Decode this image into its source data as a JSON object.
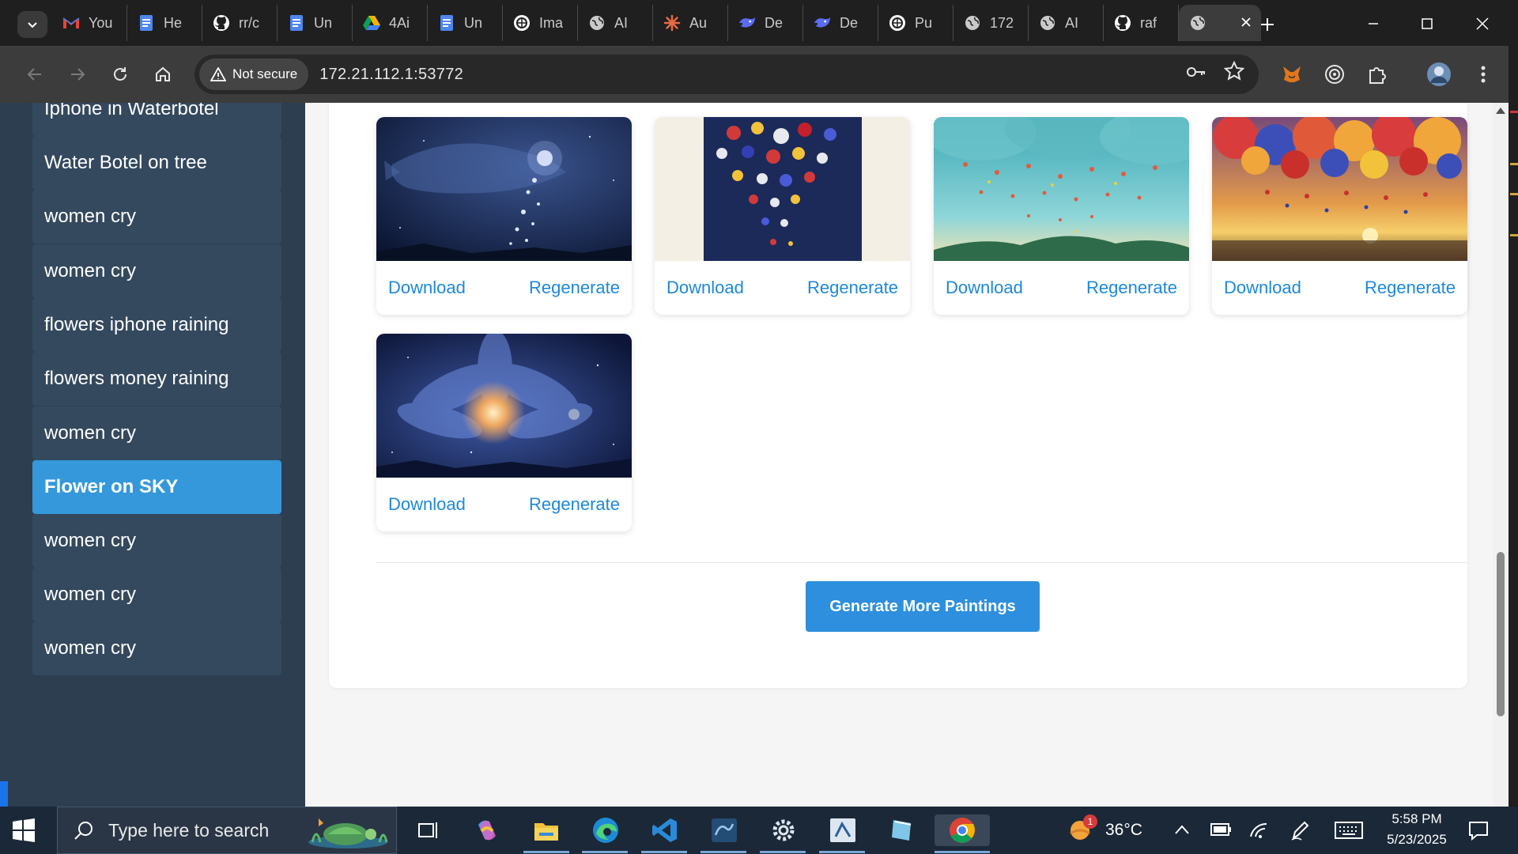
{
  "browser": {
    "tabs": [
      {
        "title": "You",
        "icon": "gmail-icon"
      },
      {
        "title": "He",
        "icon": "docs-icon"
      },
      {
        "title": "rr/c",
        "icon": "github-icon"
      },
      {
        "title": "Un",
        "icon": "docs-icon"
      },
      {
        "title": "4Ai",
        "icon": "drive-icon"
      },
      {
        "title": "Un",
        "icon": "docs-icon"
      },
      {
        "title": "Ima",
        "icon": "openai-icon"
      },
      {
        "title": "AI",
        "icon": "globe-icon"
      },
      {
        "title": "Au",
        "icon": "claude-icon"
      },
      {
        "title": "De",
        "icon": "deepseek-icon"
      },
      {
        "title": "De",
        "icon": "deepseek-icon"
      },
      {
        "title": "Pu",
        "icon": "openai-icon"
      },
      {
        "title": "172",
        "icon": "globe-icon"
      },
      {
        "title": "AI",
        "icon": "globe-icon"
      },
      {
        "title": "raf",
        "icon": "github-icon"
      }
    ],
    "active_tab_icon": "globe-icon",
    "security_label": "Not secure",
    "url": "172.21.112.1:53772"
  },
  "sidebar": {
    "items": [
      {
        "label": "Iphone in Waterbotel",
        "active": false
      },
      {
        "label": "Water Botel on tree",
        "active": false
      },
      {
        "label": "women cry",
        "active": false
      },
      {
        "label": "women cry",
        "active": false
      },
      {
        "label": "flowers iphone raining",
        "active": false
      },
      {
        "label": "flowers money raining",
        "active": false
      },
      {
        "label": "women cry",
        "active": false
      },
      {
        "label": "Flower on SKY",
        "active": true
      },
      {
        "label": "women cry",
        "active": false
      },
      {
        "label": "women cry",
        "active": false
      },
      {
        "label": "women cry",
        "active": false
      }
    ]
  },
  "gallery": {
    "cards": [
      {
        "image": "starry-whale-painting",
        "download_label": "Download",
        "regenerate_label": "Regenerate"
      },
      {
        "image": "falling-flowers-night-painting",
        "download_label": "Download",
        "regenerate_label": "Regenerate"
      },
      {
        "image": "teal-sky-flower-rain-painting",
        "download_label": "Download",
        "regenerate_label": "Regenerate"
      },
      {
        "image": "sunset-flower-clouds-painting",
        "download_label": "Download",
        "regenerate_label": "Regenerate"
      },
      {
        "image": "cosmic-lotus-painting",
        "download_label": "Download",
        "regenerate_label": "Regenerate"
      }
    ],
    "generate_more_label": "Generate More Paintings"
  },
  "taskbar": {
    "search_placeholder": "Type here to search",
    "weather_temp": "36°C",
    "weather_badge": "1",
    "time": "5:58 PM",
    "date": "5/23/2025",
    "apps": [
      "copilot-icon",
      "file-explorer-icon",
      "edge-icon",
      "vscode-icon",
      "mysql-workbench-icon",
      "settings-icon",
      "ssms-icon",
      "notes-icon",
      "chrome-icon"
    ]
  },
  "colors": {
    "sidebar_bg": "#2c3e50",
    "sidebar_item": "#34495e",
    "sidebar_active": "#3498db",
    "link": "#1e88d8",
    "button": "#2d8fdd"
  }
}
